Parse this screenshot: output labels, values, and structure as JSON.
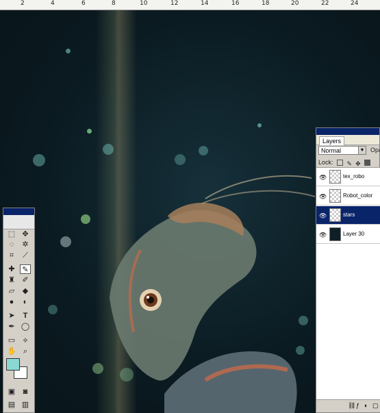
{
  "ruler": {
    "labels": [
      "2",
      "4",
      "6",
      "8",
      "10",
      "12",
      "14",
      "16",
      "18",
      "20",
      "22",
      "24"
    ]
  },
  "colors": {
    "foreground": "#8ad7d4",
    "background": "#ffffff",
    "selection": "#0a246a"
  },
  "layers_panel": {
    "tab": "Layers",
    "blend_mode": "Normal",
    "opacity_label": "Opa",
    "lock_label": "Lock:",
    "layers": [
      {
        "name": "tex_robo",
        "visible": true,
        "selected": false
      },
      {
        "name": "Robot_color",
        "visible": true,
        "selected": false
      },
      {
        "name": "stars",
        "visible": true,
        "selected": true
      },
      {
        "name": "Layer 30",
        "visible": true,
        "selected": false
      }
    ]
  },
  "toolbox": {
    "tool_icons": [
      "marquee-icon",
      "move-icon",
      "lasso-icon",
      "magic-wand-icon",
      "crop-icon",
      "slice-icon",
      "healing-brush-icon",
      "brush-icon",
      "clone-stamp-icon",
      "history-brush-icon",
      "eraser-icon",
      "paint-bucket-icon",
      "blur-icon",
      "dodge-icon",
      "path-select-icon",
      "type-icon",
      "pen-icon",
      "shape-icon",
      "notes-icon",
      "eyedropper-icon",
      "hand-icon",
      "zoom-icon"
    ]
  }
}
